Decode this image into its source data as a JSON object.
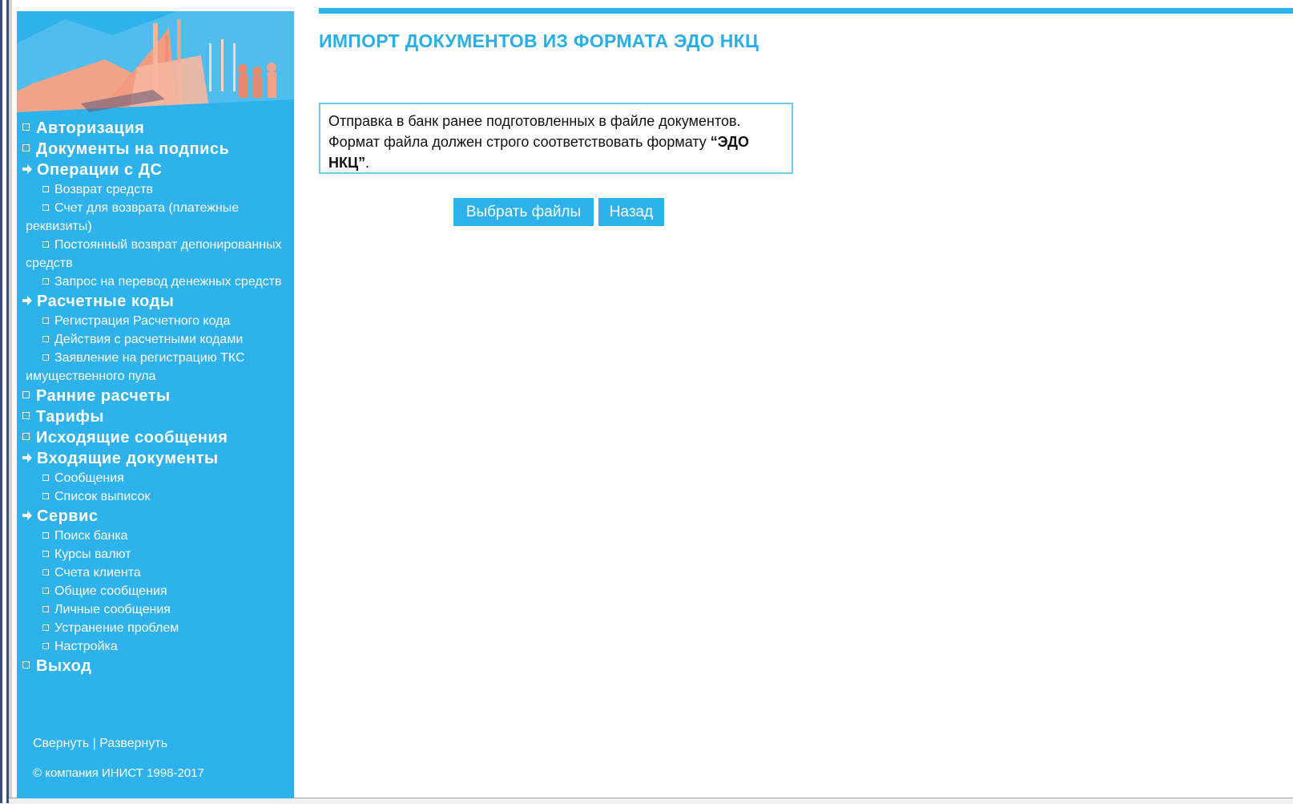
{
  "page": {
    "title": "ИМПОРТ ДОКУМЕНТОВ ИЗ ФОРМАТА ЭДО НКЦ",
    "info_text_pre": "Отправка в банк ранее подготовленных в файле документов. Формат файла должен строго соответствовать формату ",
    "info_text_bold": "“ЭДО НКЦ”",
    "info_text_post": ".",
    "choose_files_label": "Выбрать файлы",
    "back_label": "Назад"
  },
  "sidebar": {
    "menu": [
      {
        "label": "Авторизация",
        "icon": "square-bullet"
      },
      {
        "label": "Документы на подпись",
        "icon": "square-bullet"
      },
      {
        "label": "Операции с ДС",
        "icon": "arrow-right",
        "children": [
          "Возврат средств",
          "Счет для возврата (платежные реквизиты)",
          "Постоянный возврат депонированных средств",
          "Запрос на перевод денежных средств"
        ]
      },
      {
        "label": "Расчетные коды",
        "icon": "arrow-right",
        "children": [
          "Регистрация Расчетного кода",
          "Действия с расчетными кодами",
          "Заявление на регистрацию ТКС имущественного пула"
        ]
      },
      {
        "label": "Ранние расчеты",
        "icon": "square-bullet"
      },
      {
        "label": "Тарифы",
        "icon": "square-bullet"
      },
      {
        "label": "Исходящие сообщения",
        "icon": "square-bullet"
      },
      {
        "label": "Входящие документы",
        "icon": "arrow-right",
        "children": [
          "Сообщения",
          "Список выписок"
        ]
      },
      {
        "label": "Сервис",
        "icon": "arrow-right",
        "children": [
          "Поиск банка",
          "Курсы валют",
          "Счета клиента",
          "Общие сообщения",
          "Личные сообщения",
          "Устранение проблем",
          "Настройка"
        ]
      },
      {
        "label": "Выход",
        "icon": "square-bullet"
      }
    ],
    "collapse_label": "Свернуть",
    "separator": "|",
    "expand_label": "Развернуть",
    "copyright": "© компания ИНИСТ  1998-2017"
  },
  "colors": {
    "accent": "#2eb2ec",
    "title": "#2aaee8",
    "banner": "#f0a48a"
  }
}
